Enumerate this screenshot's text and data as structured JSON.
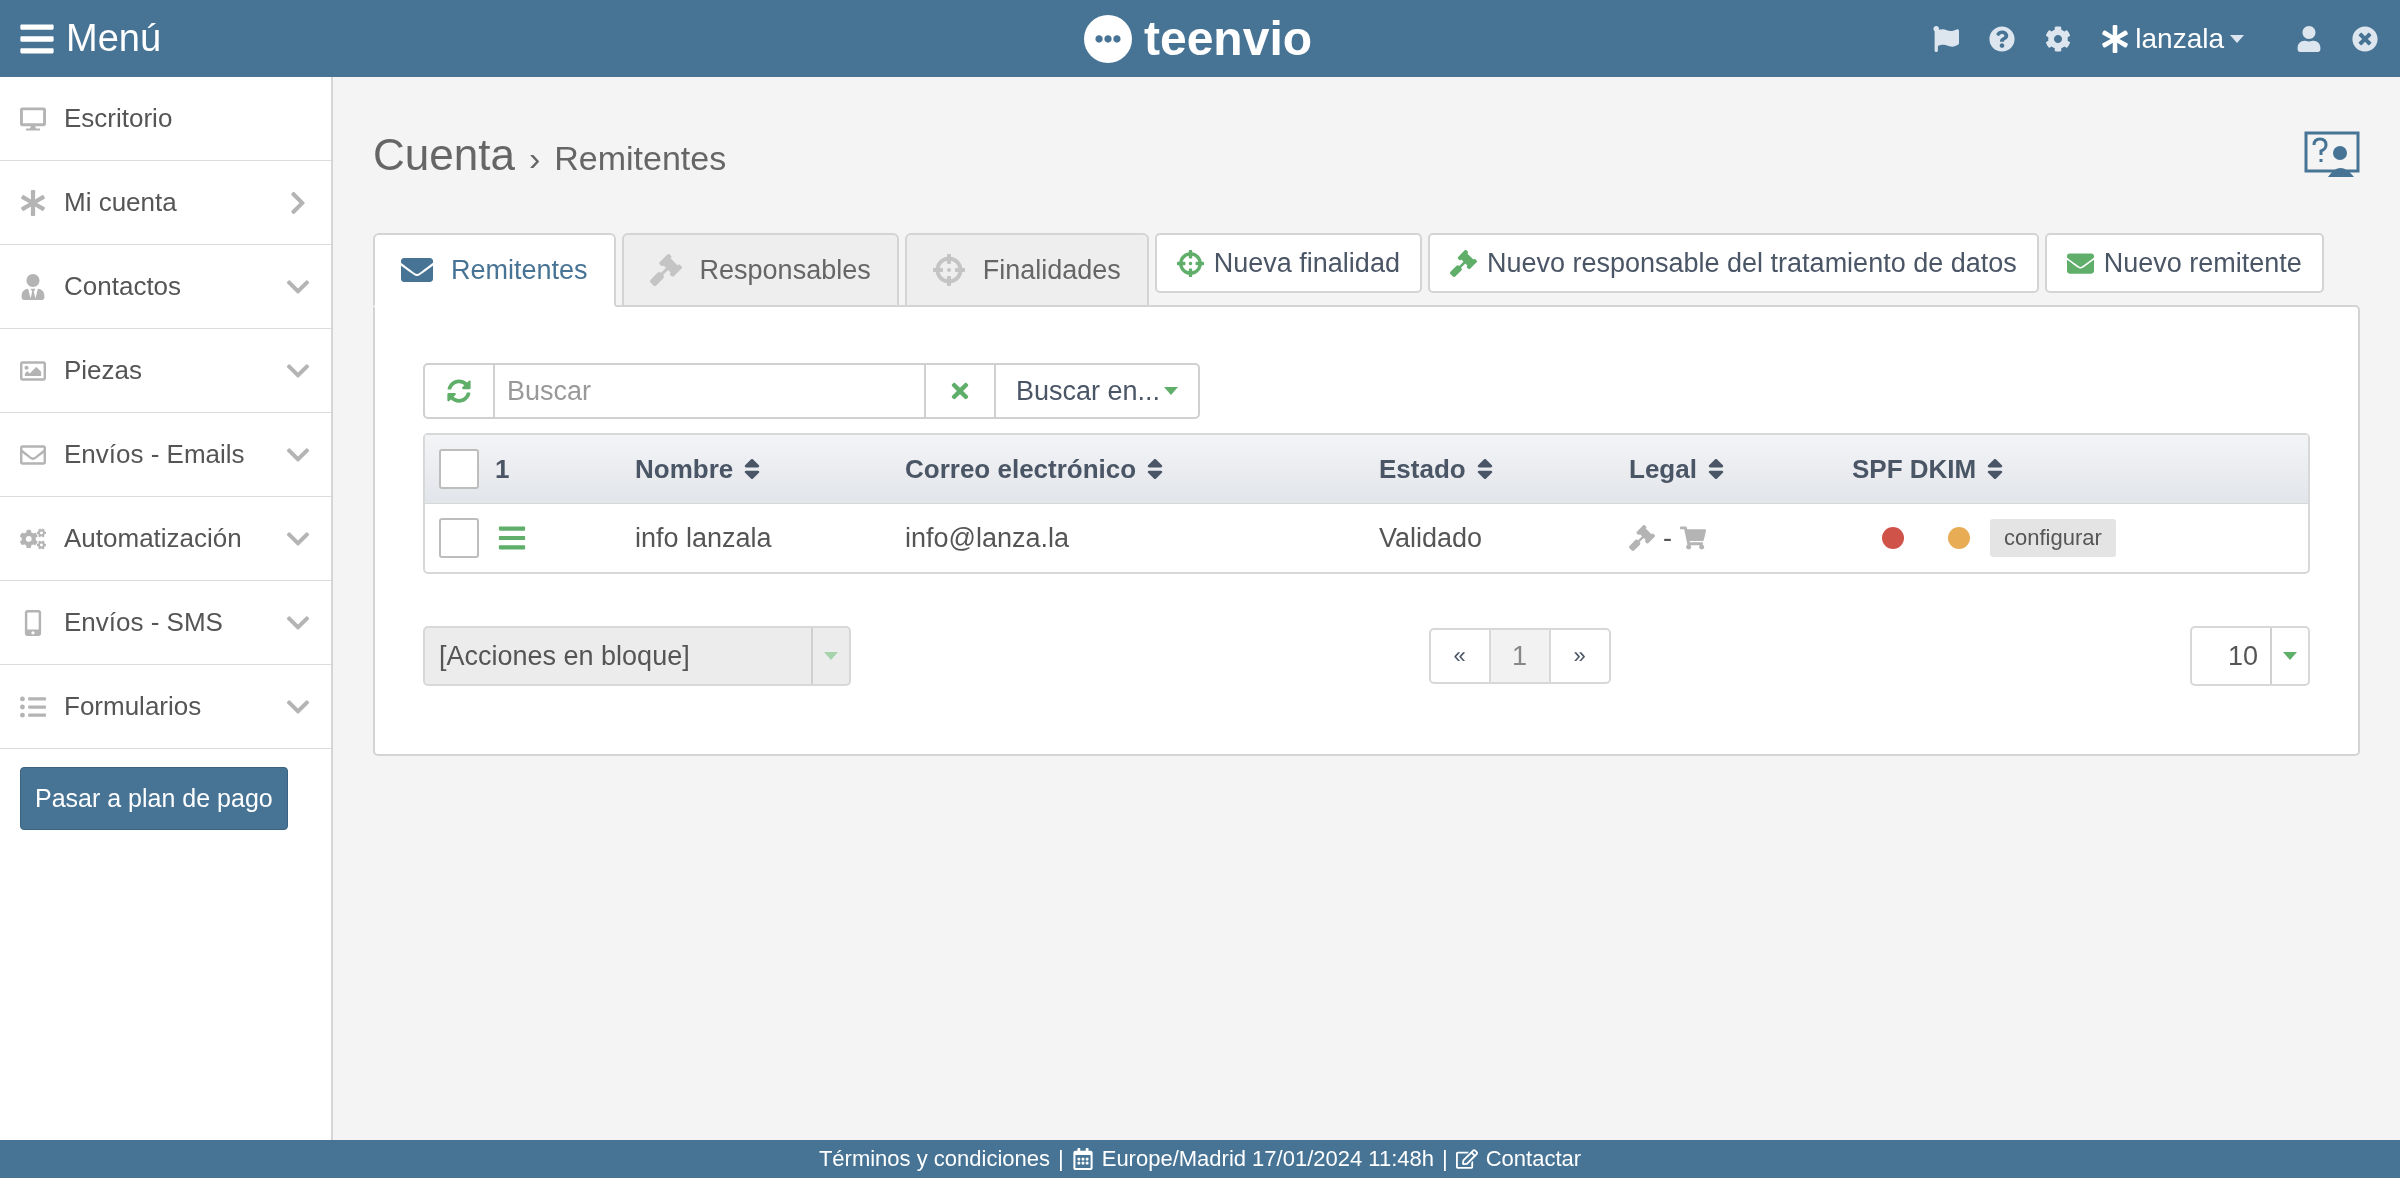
{
  "header": {
    "menu_label": "Menú",
    "logo": "teenvio",
    "user": "lanzala"
  },
  "sidebar": {
    "items": [
      {
        "label": "Escritorio",
        "kind": "plain"
      },
      {
        "label": "Mi cuenta",
        "kind": "link"
      },
      {
        "label": "Contactos",
        "kind": "submenu"
      },
      {
        "label": "Piezas",
        "kind": "submenu"
      },
      {
        "label": "Envíos - Emails",
        "kind": "submenu"
      },
      {
        "label": "Automatización",
        "kind": "submenu"
      },
      {
        "label": "Envíos - SMS",
        "kind": "submenu"
      },
      {
        "label": "Formularios",
        "kind": "submenu"
      }
    ],
    "upgrade_button": "Pasar a plan de pago"
  },
  "breadcrumb": {
    "section": "Cuenta",
    "separator": "›",
    "page": "Remitentes"
  },
  "tabs": [
    {
      "label": "Remitentes",
      "selected": true
    },
    {
      "label": "Responsables",
      "selected": false
    },
    {
      "label": "Finalidades",
      "selected": false
    }
  ],
  "actions": [
    "Nueva finalidad",
    "Nuevo responsable del tratamiento de datos",
    "Nuevo remitente"
  ],
  "search": {
    "placeholder": "Buscar",
    "scope": "Buscar en..."
  },
  "table": {
    "select_all": {
      "checked": false,
      "count": "1"
    },
    "columns": [
      "Nombre",
      "Correo electrónico",
      "Estado",
      "Legal",
      "SPF DKIM"
    ],
    "rows": [
      {
        "checked": false,
        "name": "info lanzala",
        "email": "info@lanza.la",
        "status": "Validado",
        "legal_separator": "-",
        "spf": {
          "color": "#d0534a"
        },
        "dkim": {
          "color": "#e8ac55"
        },
        "configure": "configurar"
      }
    ]
  },
  "bulk_actions": "[Acciones en bloque]",
  "pagination": {
    "prev": "«",
    "pages": [
      {
        "label": "1",
        "selected": true
      }
    ],
    "next": "»"
  },
  "per_page": "10",
  "footer": {
    "terms": "Términos y condiciones",
    "sep1": "|",
    "datetime": "Europe/Madrid 17/01/2024 11:48h",
    "sep2": "|",
    "contact": "Contactar"
  }
}
